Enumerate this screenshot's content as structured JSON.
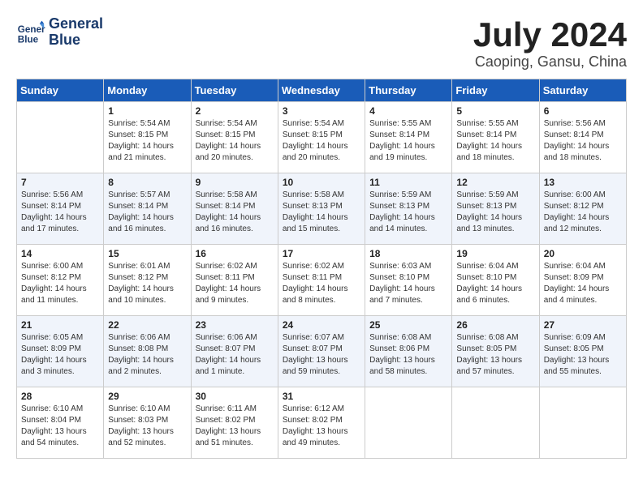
{
  "header": {
    "logo_line1": "General",
    "logo_line2": "Blue",
    "month_title": "July 2024",
    "location": "Caoping, Gansu, China"
  },
  "columns": [
    "Sunday",
    "Monday",
    "Tuesday",
    "Wednesday",
    "Thursday",
    "Friday",
    "Saturday"
  ],
  "weeks": [
    [
      {
        "day": "",
        "info": ""
      },
      {
        "day": "1",
        "info": "Sunrise: 5:54 AM\nSunset: 8:15 PM\nDaylight: 14 hours\nand 21 minutes."
      },
      {
        "day": "2",
        "info": "Sunrise: 5:54 AM\nSunset: 8:15 PM\nDaylight: 14 hours\nand 20 minutes."
      },
      {
        "day": "3",
        "info": "Sunrise: 5:54 AM\nSunset: 8:15 PM\nDaylight: 14 hours\nand 20 minutes."
      },
      {
        "day": "4",
        "info": "Sunrise: 5:55 AM\nSunset: 8:14 PM\nDaylight: 14 hours\nand 19 minutes."
      },
      {
        "day": "5",
        "info": "Sunrise: 5:55 AM\nSunset: 8:14 PM\nDaylight: 14 hours\nand 18 minutes."
      },
      {
        "day": "6",
        "info": "Sunrise: 5:56 AM\nSunset: 8:14 PM\nDaylight: 14 hours\nand 18 minutes."
      }
    ],
    [
      {
        "day": "7",
        "info": "Sunrise: 5:56 AM\nSunset: 8:14 PM\nDaylight: 14 hours\nand 17 minutes."
      },
      {
        "day": "8",
        "info": "Sunrise: 5:57 AM\nSunset: 8:14 PM\nDaylight: 14 hours\nand 16 minutes."
      },
      {
        "day": "9",
        "info": "Sunrise: 5:58 AM\nSunset: 8:14 PM\nDaylight: 14 hours\nand 16 minutes."
      },
      {
        "day": "10",
        "info": "Sunrise: 5:58 AM\nSunset: 8:13 PM\nDaylight: 14 hours\nand 15 minutes."
      },
      {
        "day": "11",
        "info": "Sunrise: 5:59 AM\nSunset: 8:13 PM\nDaylight: 14 hours\nand 14 minutes."
      },
      {
        "day": "12",
        "info": "Sunrise: 5:59 AM\nSunset: 8:13 PM\nDaylight: 14 hours\nand 13 minutes."
      },
      {
        "day": "13",
        "info": "Sunrise: 6:00 AM\nSunset: 8:12 PM\nDaylight: 14 hours\nand 12 minutes."
      }
    ],
    [
      {
        "day": "14",
        "info": "Sunrise: 6:00 AM\nSunset: 8:12 PM\nDaylight: 14 hours\nand 11 minutes."
      },
      {
        "day": "15",
        "info": "Sunrise: 6:01 AM\nSunset: 8:12 PM\nDaylight: 14 hours\nand 10 minutes."
      },
      {
        "day": "16",
        "info": "Sunrise: 6:02 AM\nSunset: 8:11 PM\nDaylight: 14 hours\nand 9 minutes."
      },
      {
        "day": "17",
        "info": "Sunrise: 6:02 AM\nSunset: 8:11 PM\nDaylight: 14 hours\nand 8 minutes."
      },
      {
        "day": "18",
        "info": "Sunrise: 6:03 AM\nSunset: 8:10 PM\nDaylight: 14 hours\nand 7 minutes."
      },
      {
        "day": "19",
        "info": "Sunrise: 6:04 AM\nSunset: 8:10 PM\nDaylight: 14 hours\nand 6 minutes."
      },
      {
        "day": "20",
        "info": "Sunrise: 6:04 AM\nSunset: 8:09 PM\nDaylight: 14 hours\nand 4 minutes."
      }
    ],
    [
      {
        "day": "21",
        "info": "Sunrise: 6:05 AM\nSunset: 8:09 PM\nDaylight: 14 hours\nand 3 minutes."
      },
      {
        "day": "22",
        "info": "Sunrise: 6:06 AM\nSunset: 8:08 PM\nDaylight: 14 hours\nand 2 minutes."
      },
      {
        "day": "23",
        "info": "Sunrise: 6:06 AM\nSunset: 8:07 PM\nDaylight: 14 hours\nand 1 minute."
      },
      {
        "day": "24",
        "info": "Sunrise: 6:07 AM\nSunset: 8:07 PM\nDaylight: 13 hours\nand 59 minutes."
      },
      {
        "day": "25",
        "info": "Sunrise: 6:08 AM\nSunset: 8:06 PM\nDaylight: 13 hours\nand 58 minutes."
      },
      {
        "day": "26",
        "info": "Sunrise: 6:08 AM\nSunset: 8:05 PM\nDaylight: 13 hours\nand 57 minutes."
      },
      {
        "day": "27",
        "info": "Sunrise: 6:09 AM\nSunset: 8:05 PM\nDaylight: 13 hours\nand 55 minutes."
      }
    ],
    [
      {
        "day": "28",
        "info": "Sunrise: 6:10 AM\nSunset: 8:04 PM\nDaylight: 13 hours\nand 54 minutes."
      },
      {
        "day": "29",
        "info": "Sunrise: 6:10 AM\nSunset: 8:03 PM\nDaylight: 13 hours\nand 52 minutes."
      },
      {
        "day": "30",
        "info": "Sunrise: 6:11 AM\nSunset: 8:02 PM\nDaylight: 13 hours\nand 51 minutes."
      },
      {
        "day": "31",
        "info": "Sunrise: 6:12 AM\nSunset: 8:02 PM\nDaylight: 13 hours\nand 49 minutes."
      },
      {
        "day": "",
        "info": ""
      },
      {
        "day": "",
        "info": ""
      },
      {
        "day": "",
        "info": ""
      }
    ]
  ]
}
